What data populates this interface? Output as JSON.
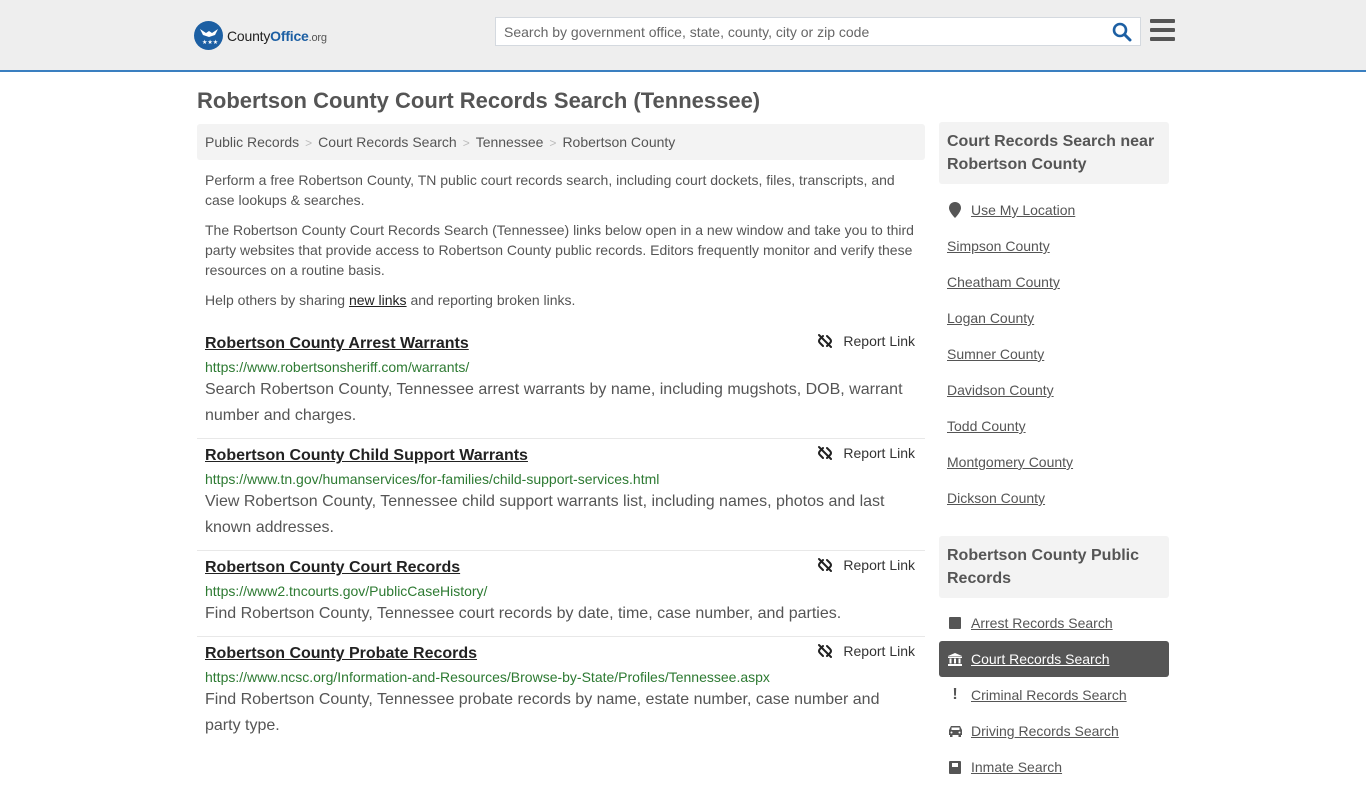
{
  "header": {
    "logo": {
      "name_part1": "County",
      "name_part2": "Office",
      "name_part3": ".org"
    },
    "search": {
      "placeholder": "Search by government office, state, county, city or zip code",
      "value": ""
    },
    "colors": {
      "accent": "#3a7fc0",
      "brand": "#1c5fa3"
    }
  },
  "page": {
    "title": "Robertson County Court Records Search (Tennessee)"
  },
  "breadcrumb": [
    {
      "label": "Public Records"
    },
    {
      "label": "Court Records Search"
    },
    {
      "label": "Tennessee"
    },
    {
      "label": "Robertson County"
    }
  ],
  "intro": {
    "p1": "Perform a free Robertson County, TN public court records search, including court dockets, files, transcripts, and case lookups & searches.",
    "p2": "The Robertson County Court Records Search (Tennessee) links below open in a new window and take you to third party websites that provide access to Robertson County public records. Editors frequently monitor and verify these resources on a routine basis.",
    "p3_before": "Help others by sharing ",
    "p3_link": "new links",
    "p3_after": " and reporting broken links."
  },
  "results": [
    {
      "title": "Robertson County Arrest Warrants",
      "url": "https://www.robertsonsheriff.com/warrants/",
      "description": "Search Robertson County, Tennessee arrest warrants by name, including mugshots, DOB, warrant number and charges.",
      "report_label": "Report Link"
    },
    {
      "title": "Robertson County Child Support Warrants",
      "url": "https://www.tn.gov/humanservices/for-families/child-support-services.html",
      "description": "View Robertson County, Tennessee child support warrants list, including names, photos and last known addresses.",
      "report_label": "Report Link"
    },
    {
      "title": "Robertson County Court Records",
      "url": "https://www2.tncourts.gov/PublicCaseHistory/",
      "description": "Find Robertson County, Tennessee court records by date, time, case number, and parties.",
      "report_label": "Report Link"
    },
    {
      "title": "Robertson County Probate Records",
      "url": "https://www.ncsc.org/Information-and-Resources/Browse-by-State/Profiles/Tennessee.aspx",
      "description": "Find Robertson County, Tennessee probate records by name, estate number, case number and party type.",
      "report_label": "Report Link"
    }
  ],
  "sidebar": {
    "nearby": {
      "heading": "Court Records Search near Robertson County",
      "use_location": "Use My Location",
      "items": [
        {
          "label": "Simpson County"
        },
        {
          "label": "Cheatham County"
        },
        {
          "label": "Logan County"
        },
        {
          "label": "Sumner County"
        },
        {
          "label": "Davidson County"
        },
        {
          "label": "Todd County"
        },
        {
          "label": "Montgomery County"
        },
        {
          "label": "Dickson County"
        }
      ]
    },
    "public_records": {
      "heading": "Robertson County Public Records",
      "items": [
        {
          "label": "Arrest Records Search",
          "icon": "square-icon",
          "active": false
        },
        {
          "label": "Court Records Search",
          "icon": "courthouse-icon",
          "active": true
        },
        {
          "label": "Criminal Records Search",
          "icon": "exclamation-icon",
          "active": false
        },
        {
          "label": "Driving Records Search",
          "icon": "car-icon",
          "active": false
        },
        {
          "label": "Inmate Search",
          "icon": "inmate-icon",
          "active": false
        }
      ]
    }
  }
}
